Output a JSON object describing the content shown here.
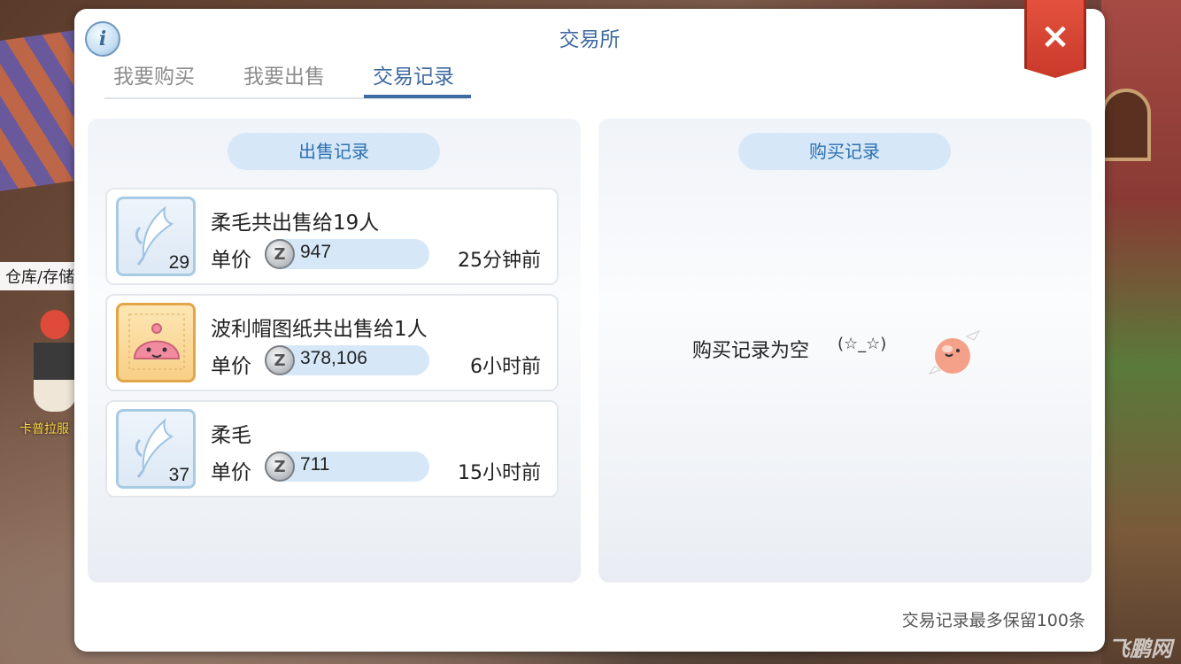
{
  "background": {
    "storage_label": "仓库/存储",
    "npc_name": "卡普拉服"
  },
  "window": {
    "title": "交易所",
    "close_icon": "×",
    "info_icon": "i"
  },
  "tabs": [
    {
      "label": "我要购买",
      "active": false
    },
    {
      "label": "我要出售",
      "active": false
    },
    {
      "label": "交易记录",
      "active": true
    }
  ],
  "sell_records": {
    "header": "出售记录",
    "price_label": "单价",
    "zeny_icon": "Z",
    "items": [
      {
        "icon": "feather-icon",
        "quantity": "29",
        "name": "柔毛共出售给19人",
        "price": "947",
        "time": "25分钟前"
      },
      {
        "icon": "poring-hat-blueprint-icon",
        "quantity": "",
        "name": "波利帽图纸共出售给1人",
        "price": "378,106",
        "time": "6小时前"
      },
      {
        "icon": "feather-icon",
        "quantity": "37",
        "name": "柔毛",
        "price": "711",
        "time": "15小时前"
      }
    ]
  },
  "buy_records": {
    "header": "购买记录",
    "empty_text": "购买记录为空",
    "empty_face": "(☆_☆)"
  },
  "footer": "交易记录最多保留100条",
  "watermark": "飞鹏网"
}
